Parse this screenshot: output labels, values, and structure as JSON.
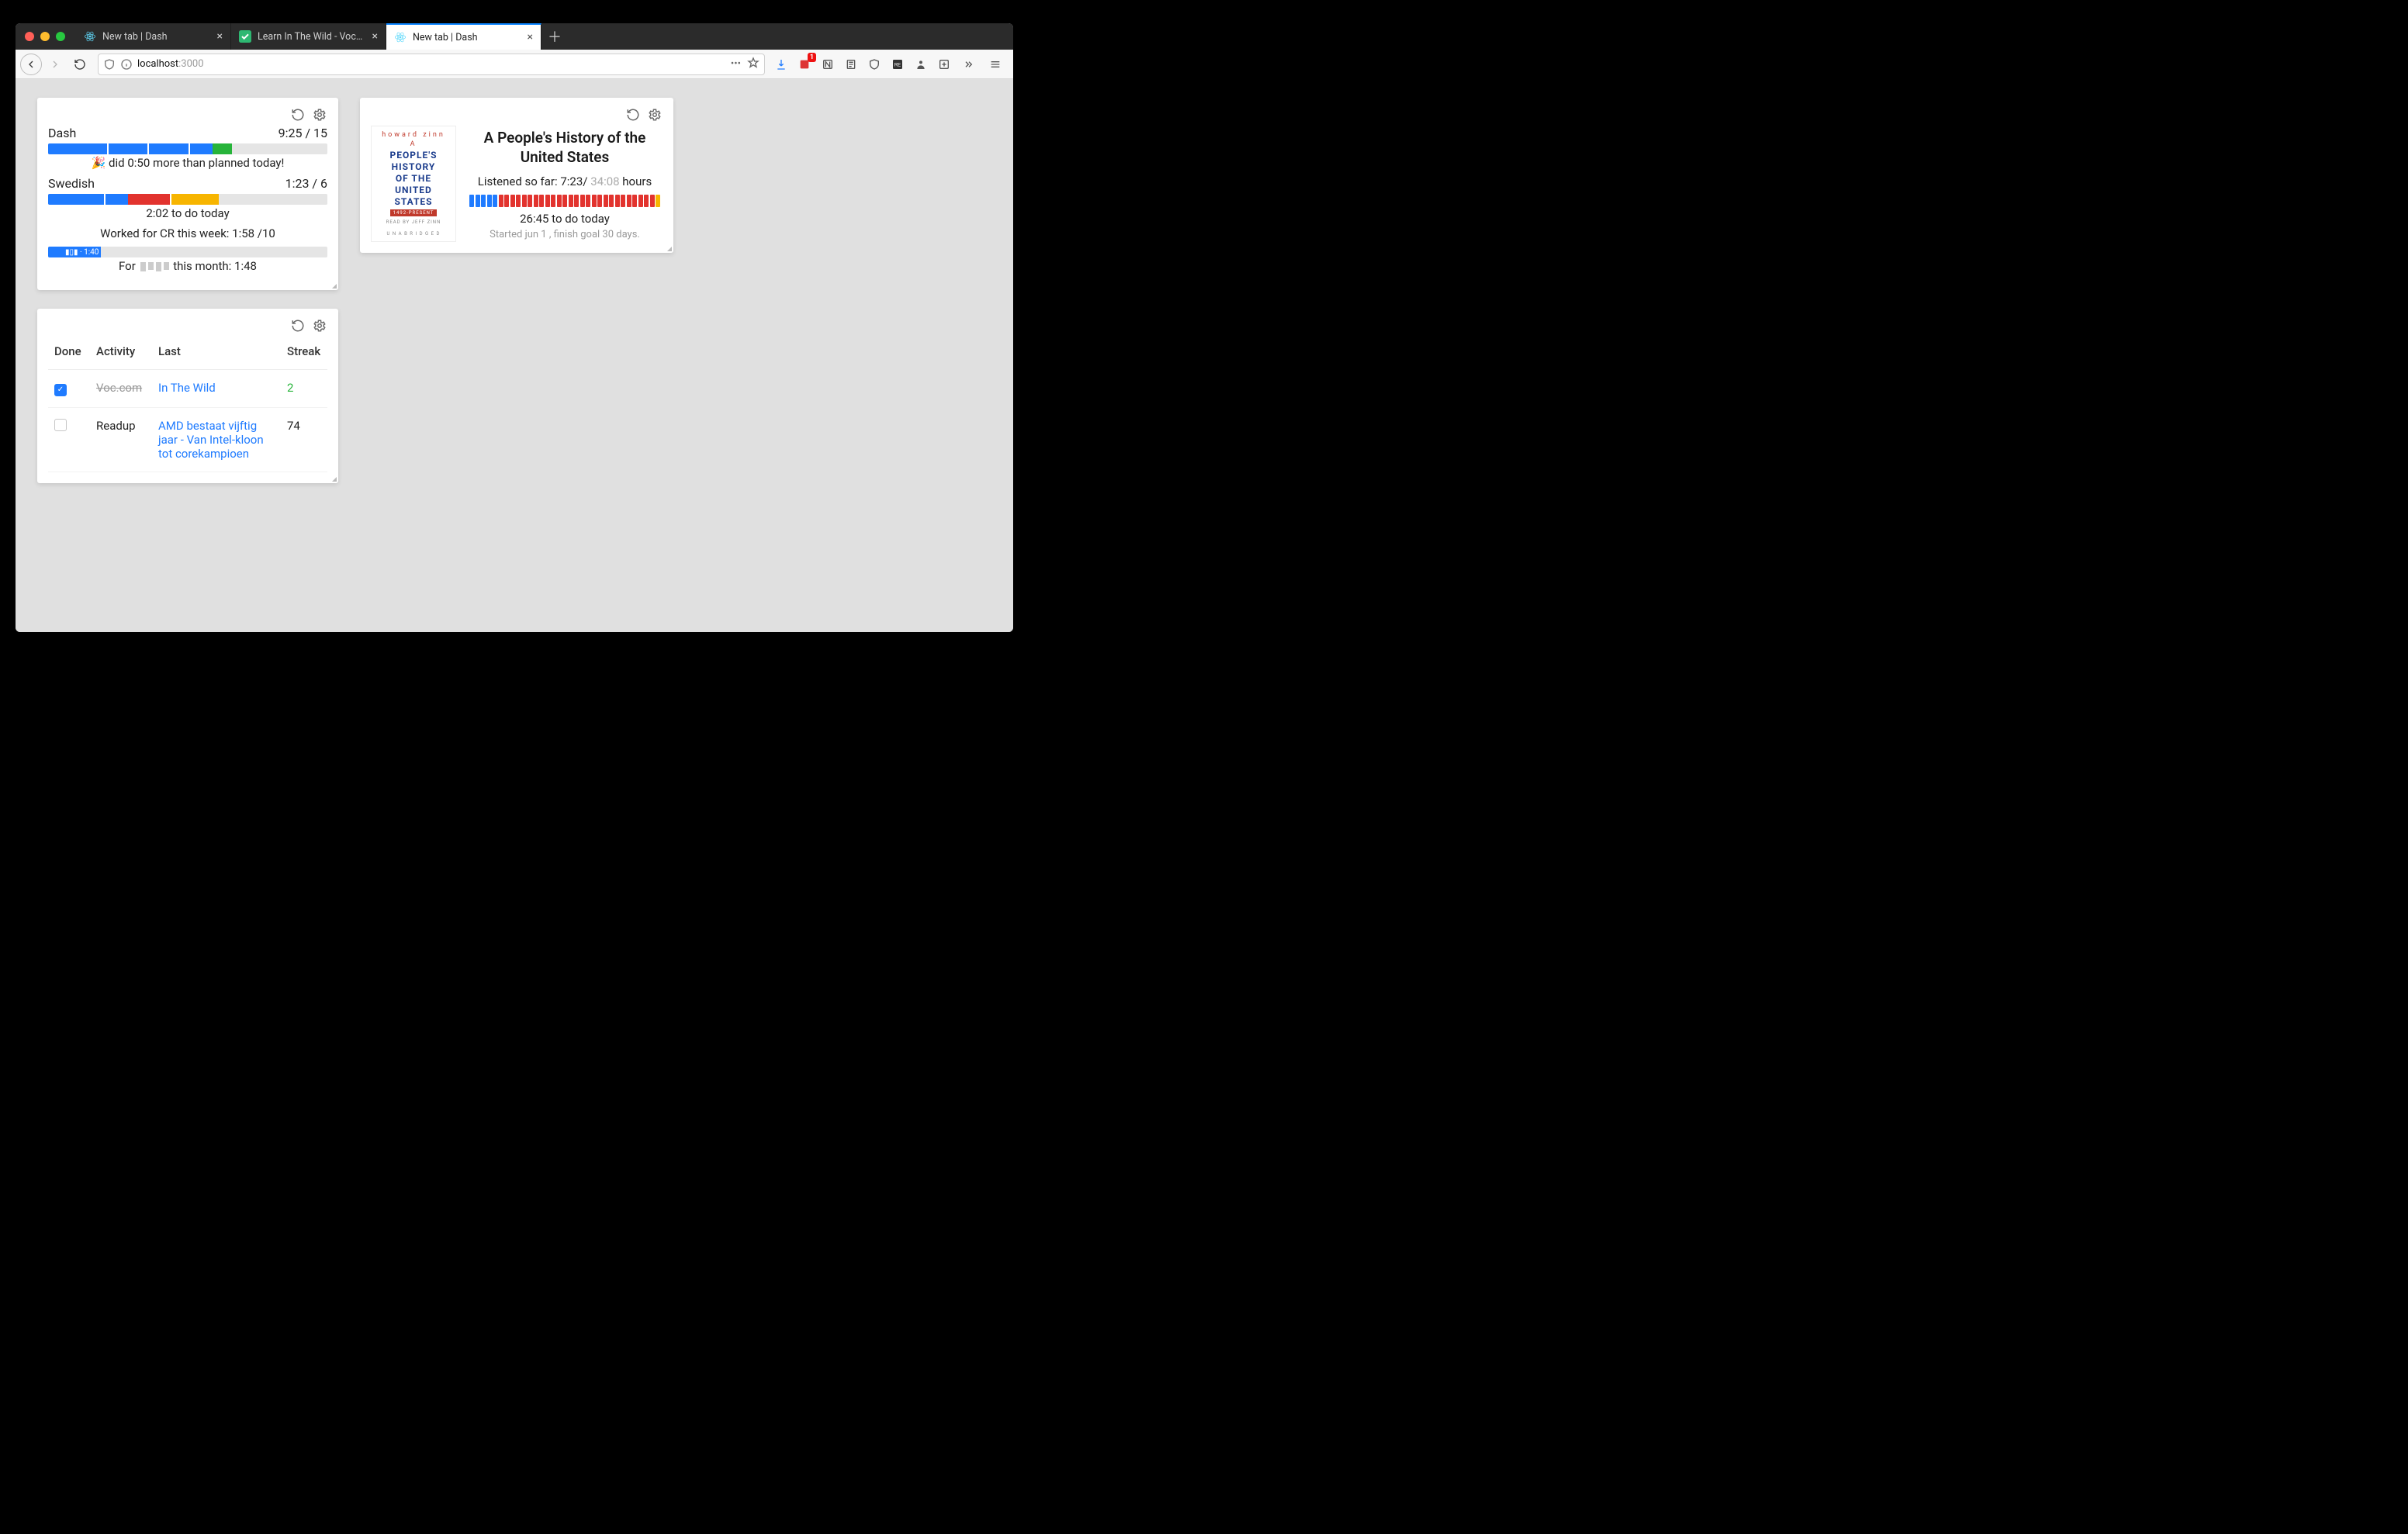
{
  "browser": {
    "tabs": [
      {
        "title": "New tab | Dash",
        "active": false,
        "favicon": "react"
      },
      {
        "title": "Learn In The Wild - Vocabulary",
        "active": false,
        "favicon": "check"
      },
      {
        "title": "New tab | Dash",
        "active": true,
        "favicon": "react"
      }
    ],
    "url": {
      "host": "localhost",
      "path": ":3000"
    }
  },
  "time_card": {
    "rows": [
      {
        "label": "Dash",
        "value": "9:25 / 15",
        "segments": [
          {
            "cls": "blue",
            "w": 21
          },
          {
            "cls": "divider",
            "w": 0.6
          },
          {
            "cls": "blue",
            "w": 14
          },
          {
            "cls": "divider",
            "w": 0.6
          },
          {
            "cls": "blue",
            "w": 14
          },
          {
            "cls": "divider",
            "w": 0.6
          },
          {
            "cls": "blue",
            "w": 8
          },
          {
            "cls": "green",
            "w": 7
          },
          {
            "cls": "grey",
            "w": 34
          }
        ],
        "caption_prefix": "🎉 ",
        "caption": "did 0:50 more than planned today!"
      },
      {
        "label": "Swedish",
        "value": "1:23 / 6",
        "segments": [
          {
            "cls": "blue",
            "w": 20
          },
          {
            "cls": "divider",
            "w": 0.6
          },
          {
            "cls": "blue",
            "w": 8
          },
          {
            "cls": "red",
            "w": 15
          },
          {
            "cls": "divider",
            "w": 0.6
          },
          {
            "cls": "yellow",
            "w": 17
          },
          {
            "cls": "grey",
            "w": 39
          }
        ],
        "caption_prefix": "",
        "caption": "2:02 to do today"
      }
    ],
    "cr_line": "Worked for CR this week: 1:58 /10",
    "mini": {
      "width_pct": 19,
      "label": "· 1:40"
    },
    "month_prefix": "For ",
    "month_suffix": " this month: 1:48"
  },
  "audiobook": {
    "cover": {
      "author": "howard zinn",
      "a_line": "A",
      "title_lines": [
        "PEOPLE'S",
        "HISTORY",
        "OF THE",
        "UNITED",
        "STATES"
      ],
      "band": "1492-PRESENT",
      "reader": "READ BY JEFF ZINN",
      "foot": "U N A B R I D G E D"
    },
    "title": "A People's History of the United States",
    "listened_prefix": "Listened so far: ",
    "listened_done": "7:23",
    "listened_sep": "/ ",
    "listened_total": "34:08",
    "listened_suffix": " hours",
    "segments": [
      "blue",
      "blue",
      "blue",
      "blue",
      "blue",
      "red",
      "red",
      "red",
      "red",
      "red",
      "red",
      "red",
      "red",
      "red",
      "red",
      "red",
      "red",
      "red",
      "red",
      "red",
      "red",
      "red",
      "red",
      "red",
      "red",
      "red",
      "red",
      "red",
      "red",
      "red",
      "red",
      "red",
      "yellow"
    ],
    "todo": "26:45 to do today",
    "foot": "Started jun 1 , finish goal 30 days."
  },
  "activities": {
    "headers": {
      "done": "Done",
      "activity": "Activity",
      "last": "Last",
      "streak": "Streak"
    },
    "rows": [
      {
        "done": true,
        "activity": "Voc.com",
        "last": "In The Wild",
        "streak": "2",
        "streak_cls": "streak-good",
        "strike": true
      },
      {
        "done": false,
        "activity": "Readup",
        "last": "AMD bestaat vijftig jaar - Van Intel-kloon tot corekampioen",
        "streak": "74",
        "streak_cls": "",
        "strike": false
      }
    ]
  }
}
